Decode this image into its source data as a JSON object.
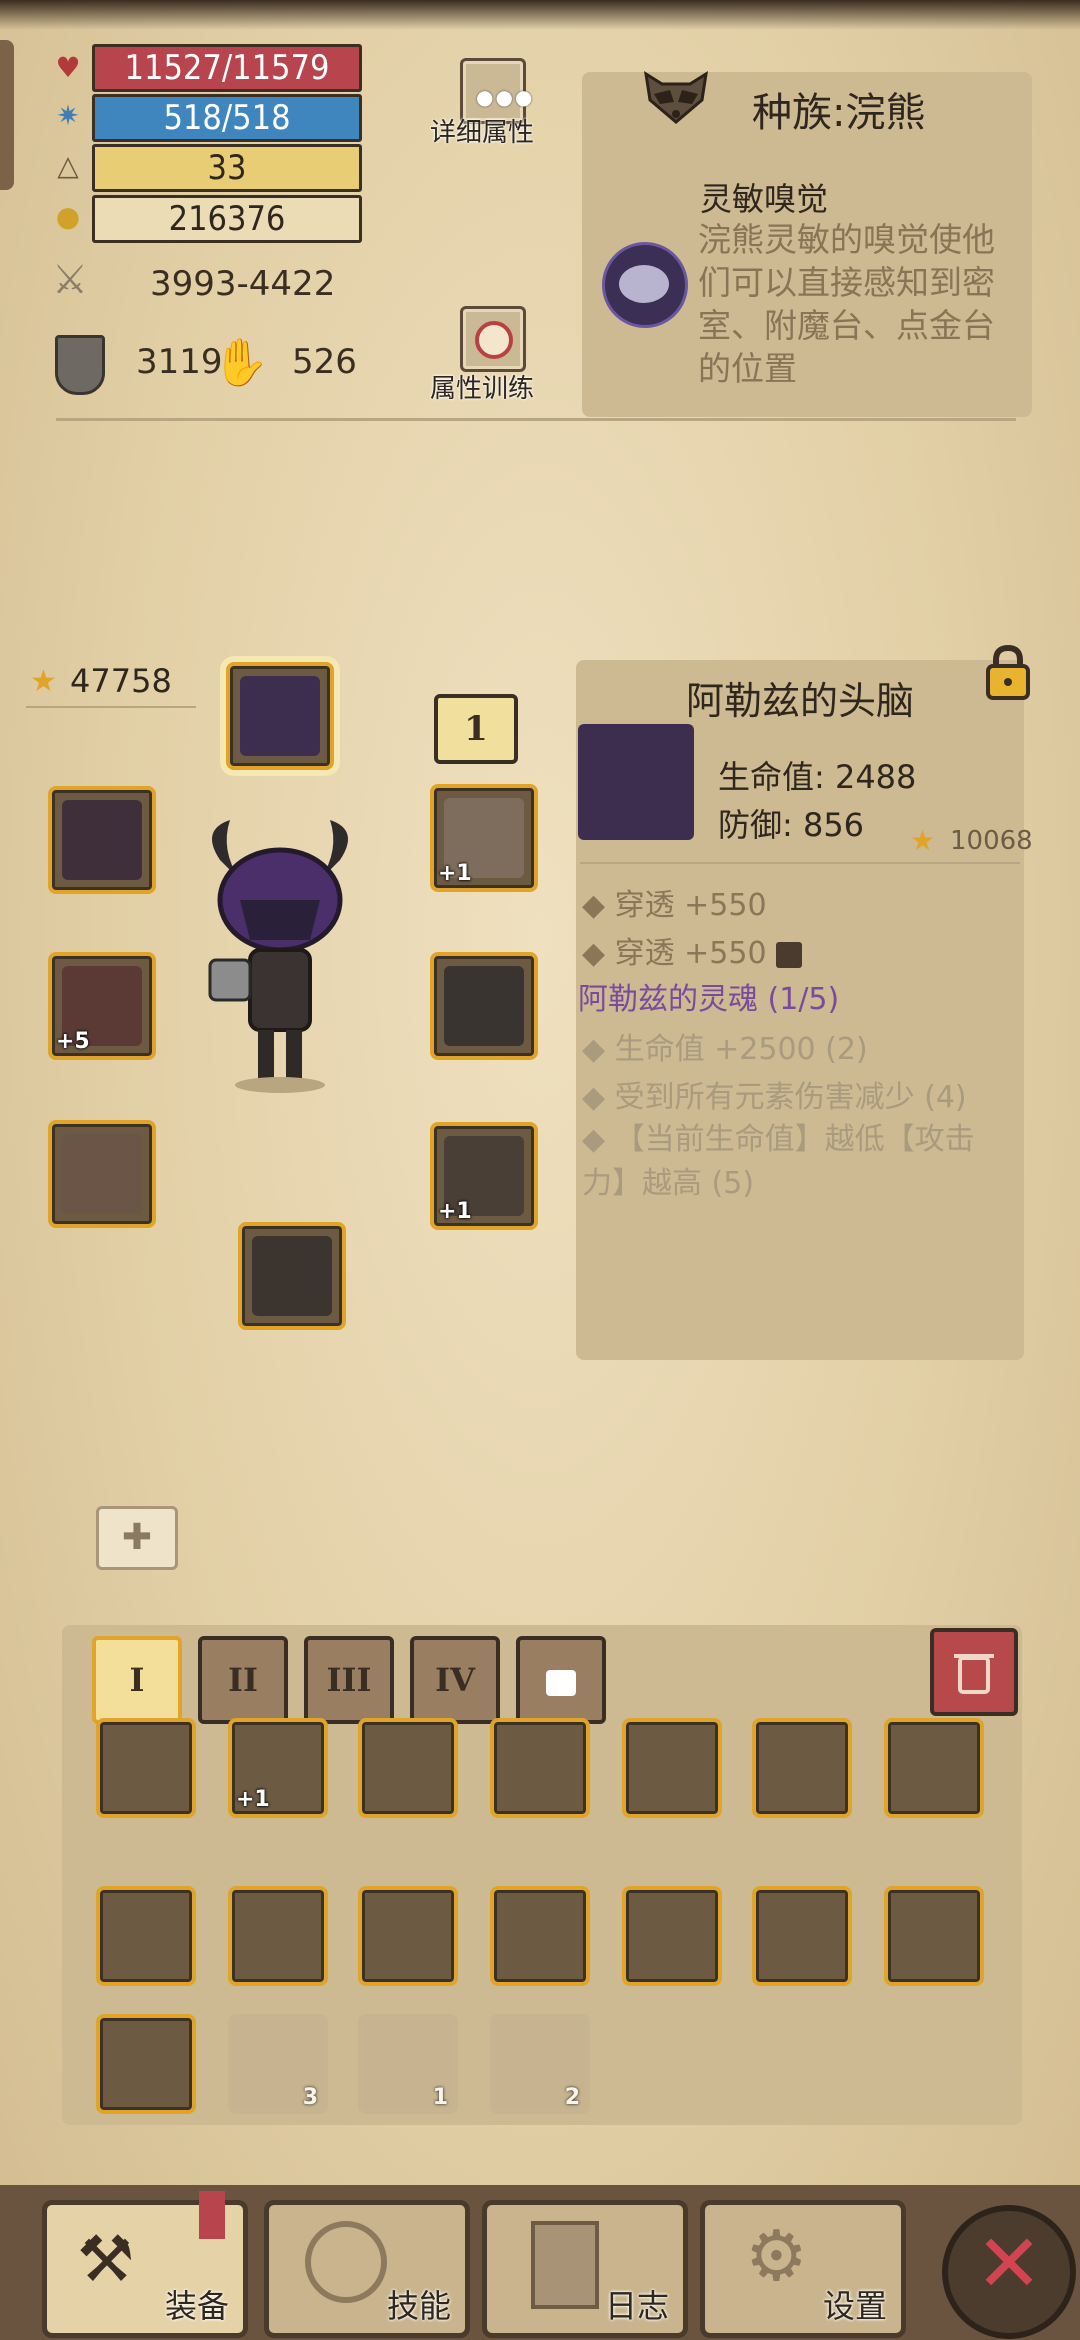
{
  "stats": {
    "hp": "11527/11579",
    "mp": "518/518",
    "level": "33",
    "gold": "216376",
    "attack": "3993-4422",
    "defense": "3119",
    "luck": "526"
  },
  "buttons": {
    "detail_attrs": "详细属性",
    "attr_training": "属性训练"
  },
  "race": {
    "title": "种族:浣熊",
    "trait_name": "灵敏嗅觉",
    "trait_desc": "浣熊灵敏的嗅觉使他们可以直接感知到密室、附魔台、点金台的位置"
  },
  "equipment": {
    "power": "47758",
    "badge": "1",
    "plus_labels": [
      "+1",
      "+5",
      "+1"
    ]
  },
  "item": {
    "name": "阿勒兹的头脑",
    "hp": "生命值: 2488",
    "defense": "防御: 856",
    "power": "10068",
    "prop1": "穿透 +550",
    "prop2": "穿透 +550",
    "set_name": "阿勒兹的灵魂 (1/5)",
    "set1": "生命值 +2500 (2)",
    "set2": "受到所有元素伤害减少 (4)",
    "set3": "【当前生命值】越低【攻击力】越高 (5)"
  },
  "inventory": {
    "tabs": [
      "I",
      "II",
      "III",
      "IV"
    ],
    "plus": "+1",
    "counts": [
      "3",
      "1",
      "2"
    ]
  },
  "nav": {
    "equip": "装备",
    "skills": "技能",
    "log": "日志",
    "settings": "设置"
  },
  "colors": {
    "hp": "#b8454d",
    "mp": "#3f86bf",
    "level": "#e8cd75",
    "gold": "#ecdcb6",
    "accent": "#e0a528",
    "set_purple": "#7a4b9c"
  }
}
